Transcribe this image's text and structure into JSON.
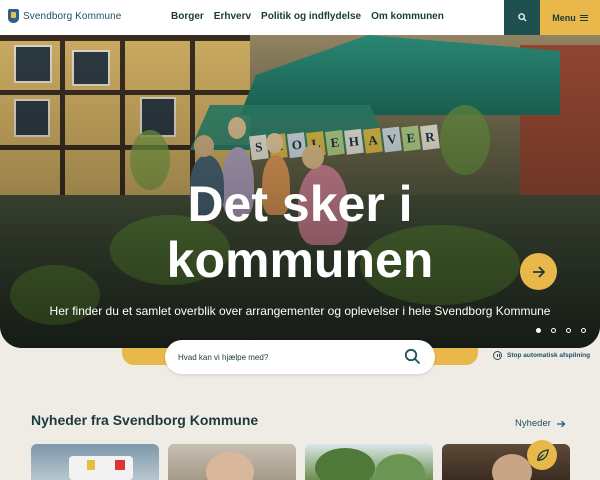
{
  "header": {
    "logo_text": "Svendborg Kommune",
    "nav": [
      "Borger",
      "Erhverv",
      "Politik og indflydelse",
      "Om kommunen"
    ],
    "menu_label": "Menu"
  },
  "hero": {
    "title_line1": "Det sker i",
    "title_line2": "kommunen",
    "subtitle": "Her finder du et samlet overblik over arrangementer og oplevelser i hele Svendborg Kommune",
    "banner_letters": [
      "S",
      "K",
      "O",
      "L",
      "E",
      "H",
      "A",
      "V",
      "E",
      "R"
    ],
    "banner_colors": [
      "#f2efe0",
      "#e7c34a",
      "#d8e7ec",
      "#e7c34a",
      "#b9d98c",
      "#f2efe0",
      "#e7c34a",
      "#d8e7ec",
      "#b9d98c",
      "#f2efe0"
    ],
    "slides_total": 4,
    "slide_active": 1
  },
  "search": {
    "placeholder": "Hvad kan vi hjælpe med?",
    "stop_autoplay_label": "Stop automatisk afspilning"
  },
  "news": {
    "heading": "Nyheder fra Svendborg Kommune",
    "link_label": "Nyheder"
  },
  "colors": {
    "accent_yellow": "#e9b84a",
    "dark_teal": "#1e4f51",
    "background": "#efece6"
  }
}
